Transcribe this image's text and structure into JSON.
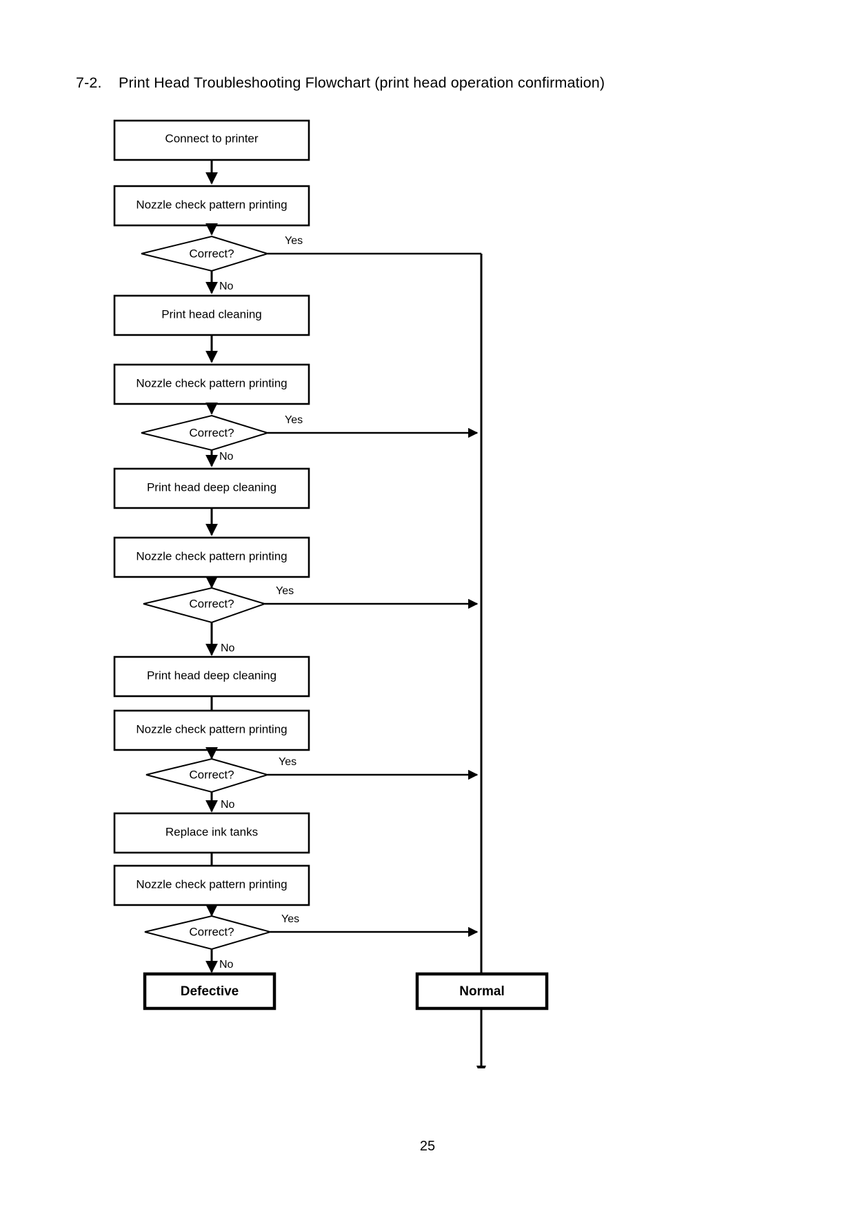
{
  "document": {
    "section_number": "7-2.",
    "title": "Print Head Troubleshooting Flowchart (print head operation confirmation)",
    "page_number": "25"
  },
  "flowchart": {
    "edge_labels": {
      "yes": "Yes",
      "no": "No"
    },
    "nodes": [
      {
        "id": "n1",
        "type": "process",
        "label": "Connect to printer"
      },
      {
        "id": "n2",
        "type": "process",
        "label": "Nozzle check pattern printing"
      },
      {
        "id": "d1",
        "type": "decision",
        "label": "Correct?"
      },
      {
        "id": "n3",
        "type": "process",
        "label": "Print head cleaning"
      },
      {
        "id": "n4",
        "type": "process",
        "label": "Nozzle check pattern printing"
      },
      {
        "id": "d2",
        "type": "decision",
        "label": "Correct?"
      },
      {
        "id": "n5",
        "type": "process",
        "label": "Print head deep cleaning"
      },
      {
        "id": "n6",
        "type": "process",
        "label": "Nozzle check pattern printing"
      },
      {
        "id": "d3",
        "type": "decision",
        "label": "Correct?"
      },
      {
        "id": "n7",
        "type": "process",
        "label": "Print head deep cleaning"
      },
      {
        "id": "n8",
        "type": "process",
        "label": "Nozzle check pattern printing"
      },
      {
        "id": "d4",
        "type": "decision",
        "label": "Correct?"
      },
      {
        "id": "n9",
        "type": "process",
        "label": "Replace ink tanks"
      },
      {
        "id": "n10",
        "type": "process",
        "label": "Nozzle check pattern printing"
      },
      {
        "id": "d5",
        "type": "decision",
        "label": "Correct?"
      },
      {
        "id": "t1",
        "type": "terminal",
        "label": "Defective"
      },
      {
        "id": "t2",
        "type": "terminal",
        "label": "Normal"
      }
    ],
    "yes_branch_labels": [
      "Yes",
      "Yes",
      "Yes",
      "Yes",
      "Yes"
    ],
    "no_branch_labels": [
      "No",
      "No",
      "No",
      "No",
      "No"
    ],
    "colors": {
      "stroke": "#000000",
      "fill": "#ffffff",
      "text": "#000000"
    }
  }
}
